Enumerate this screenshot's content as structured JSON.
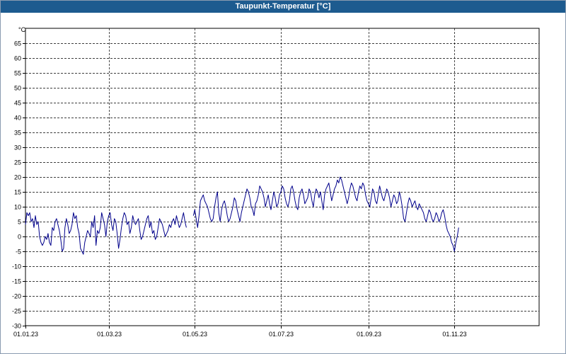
{
  "window": {
    "title": "Taupunkt-Temperatur [°C]"
  },
  "chart_data": {
    "type": "line",
    "title": "Taupunkt-Temperatur [°C]",
    "ylabel": "",
    "y_unit": "°C",
    "ylim": [
      -30,
      70
    ],
    "xlim": [
      "2023-01-01",
      "2023-12-31"
    ],
    "grid": true,
    "line_color": "#00008b",
    "y_ticks": [
      "-30",
      "-25",
      "-20",
      "-15",
      "-10",
      "-5",
      "0",
      "5",
      "10",
      "15",
      "20",
      "25",
      "30",
      "35",
      "40",
      "45",
      "50",
      "55",
      "60",
      "65"
    ],
    "x_ticks": [
      {
        "label": "01.01.23",
        "date": "2023-01-01"
      },
      {
        "label": "01.03.23",
        "date": "2023-03-01"
      },
      {
        "label": "01.05.23",
        "date": "2023-05-01"
      },
      {
        "label": "01.07.23",
        "date": "2023-07-01"
      },
      {
        "label": "01.09.23",
        "date": "2023-09-01"
      },
      {
        "label": "01.11.23",
        "date": "2023-11-01"
      }
    ],
    "series": [
      {
        "segments": [
          {
            "x": [
              "2023-01-01",
              "2023-01-02",
              "2023-01-03",
              "2023-01-04",
              "2023-01-05",
              "2023-01-06",
              "2023-01-07",
              "2023-01-08",
              "2023-01-09",
              "2023-01-10",
              "2023-01-11",
              "2023-01-12",
              "2023-01-13",
              "2023-01-14",
              "2023-01-15",
              "2023-01-16",
              "2023-01-17",
              "2023-01-18",
              "2023-01-19",
              "2023-01-20",
              "2023-01-21",
              "2023-01-22",
              "2023-01-23",
              "2023-01-24",
              "2023-01-25",
              "2023-01-26",
              "2023-01-27",
              "2023-01-28",
              "2023-01-29",
              "2023-01-30",
              "2023-01-31",
              "2023-02-01",
              "2023-02-02",
              "2023-02-03",
              "2023-02-04",
              "2023-02-05",
              "2023-02-06",
              "2023-02-07",
              "2023-02-08",
              "2023-02-09",
              "2023-02-10",
              "2023-02-11",
              "2023-02-12",
              "2023-02-13",
              "2023-02-14",
              "2023-02-15",
              "2023-02-16",
              "2023-02-17",
              "2023-02-18",
              "2023-02-19",
              "2023-02-20",
              "2023-02-21",
              "2023-02-22",
              "2023-02-23",
              "2023-02-24",
              "2023-02-25",
              "2023-02-26",
              "2023-02-27",
              "2023-02-28",
              "2023-03-01",
              "2023-03-02",
              "2023-03-03",
              "2023-03-04",
              "2023-03-05",
              "2023-03-06",
              "2023-03-07",
              "2023-03-08",
              "2023-03-09",
              "2023-03-10",
              "2023-03-11",
              "2023-03-12",
              "2023-03-13",
              "2023-03-14",
              "2023-03-15",
              "2023-03-16",
              "2023-03-17",
              "2023-03-18",
              "2023-03-19",
              "2023-03-20",
              "2023-03-21",
              "2023-03-22",
              "2023-03-23",
              "2023-03-24",
              "2023-03-25",
              "2023-03-26",
              "2023-03-27",
              "2023-03-28",
              "2023-03-29",
              "2023-03-30",
              "2023-03-31",
              "2023-04-01",
              "2023-04-02",
              "2023-04-03",
              "2023-04-04",
              "2023-04-05",
              "2023-04-06",
              "2023-04-07",
              "2023-04-08",
              "2023-04-09",
              "2023-04-10",
              "2023-04-11",
              "2023-04-12",
              "2023-04-13",
              "2023-04-14",
              "2023-04-15",
              "2023-04-16",
              "2023-04-17",
              "2023-04-18",
              "2023-04-19",
              "2023-04-20",
              "2023-04-21",
              "2023-04-22",
              "2023-04-23",
              "2023-04-24",
              "2023-04-25"
            ],
            "y": [
              4,
              8,
              7,
              8,
              5,
              6,
              3,
              7,
              4,
              5,
              0,
              -2,
              -3,
              -2,
              0,
              -1,
              1,
              -2,
              -3,
              3,
              2,
              5,
              6,
              4,
              2,
              -1,
              -5,
              -4,
              3,
              6,
              4,
              1,
              2,
              4,
              8,
              6,
              7,
              3,
              1,
              -4,
              -5,
              -6,
              -2,
              0,
              2,
              1,
              0,
              5,
              3,
              7,
              -3,
              2,
              1,
              3,
              8,
              6,
              4,
              0,
              5,
              7,
              8,
              4,
              2,
              6,
              5,
              1,
              -4,
              -1,
              3,
              6,
              8,
              7,
              4,
              5,
              1,
              3,
              7,
              5,
              4,
              5,
              6,
              2,
              -1,
              0,
              2,
              4,
              6,
              7,
              3,
              5,
              1,
              2,
              -1,
              0,
              3,
              6,
              5,
              4,
              2,
              0,
              1,
              2,
              4,
              3,
              5,
              6,
              4,
              7,
              5,
              3,
              4,
              6,
              8,
              5,
              3
            ],
            "note": ""
          },
          {
            "x": [
              "2023-04-30",
              "2023-05-01",
              "2023-05-02",
              "2023-05-03",
              "2023-05-04",
              "2023-05-05",
              "2023-05-06",
              "2023-05-07",
              "2023-05-08",
              "2023-05-09",
              "2023-05-10",
              "2023-05-11",
              "2023-05-12",
              "2023-05-13",
              "2023-05-14",
              "2023-05-15",
              "2023-05-16",
              "2023-05-17",
              "2023-05-18",
              "2023-05-19",
              "2023-05-20",
              "2023-05-21",
              "2023-05-22",
              "2023-05-23",
              "2023-05-24",
              "2023-05-25",
              "2023-05-26",
              "2023-05-27",
              "2023-05-28",
              "2023-05-29",
              "2023-05-30",
              "2023-05-31",
              "2023-06-01",
              "2023-06-02",
              "2023-06-03",
              "2023-06-04",
              "2023-06-05",
              "2023-06-06",
              "2023-06-07",
              "2023-06-08",
              "2023-06-09",
              "2023-06-10",
              "2023-06-11",
              "2023-06-12",
              "2023-06-13",
              "2023-06-14",
              "2023-06-15",
              "2023-06-16",
              "2023-06-17",
              "2023-06-18",
              "2023-06-19",
              "2023-06-20",
              "2023-06-21",
              "2023-06-22",
              "2023-06-23",
              "2023-06-24",
              "2023-06-25",
              "2023-06-26",
              "2023-06-27",
              "2023-06-28",
              "2023-06-29",
              "2023-06-30",
              "2023-07-01",
              "2023-07-02",
              "2023-07-03",
              "2023-07-04",
              "2023-07-05",
              "2023-07-06",
              "2023-07-07",
              "2023-07-08",
              "2023-07-09",
              "2023-07-10",
              "2023-07-11",
              "2023-07-12",
              "2023-07-13",
              "2023-07-14",
              "2023-07-15",
              "2023-07-16",
              "2023-07-17",
              "2023-07-18",
              "2023-07-19",
              "2023-07-20",
              "2023-07-21",
              "2023-07-22",
              "2023-07-23",
              "2023-07-24",
              "2023-07-25",
              "2023-07-26",
              "2023-07-27",
              "2023-07-28",
              "2023-07-29",
              "2023-07-30",
              "2023-07-31",
              "2023-08-01",
              "2023-08-02",
              "2023-08-03",
              "2023-08-04",
              "2023-08-05",
              "2023-08-06",
              "2023-08-07",
              "2023-08-08",
              "2023-08-09",
              "2023-08-10",
              "2023-08-11",
              "2023-08-12",
              "2023-08-13",
              "2023-08-14",
              "2023-08-15",
              "2023-08-16",
              "2023-08-17",
              "2023-08-18",
              "2023-08-19",
              "2023-08-20",
              "2023-08-21",
              "2023-08-22",
              "2023-08-23",
              "2023-08-24",
              "2023-08-25",
              "2023-08-26",
              "2023-08-27",
              "2023-08-28",
              "2023-08-29",
              "2023-08-30",
              "2023-08-31",
              "2023-09-01",
              "2023-09-02",
              "2023-09-03",
              "2023-09-04",
              "2023-09-05",
              "2023-09-06",
              "2023-09-07",
              "2023-09-08",
              "2023-09-09",
              "2023-09-10",
              "2023-09-11",
              "2023-09-12",
              "2023-09-13",
              "2023-09-14",
              "2023-09-15",
              "2023-09-16",
              "2023-09-17",
              "2023-09-18",
              "2023-09-19",
              "2023-09-20",
              "2023-09-21",
              "2023-09-22",
              "2023-09-23",
              "2023-09-24",
              "2023-09-25",
              "2023-09-26",
              "2023-09-27",
              "2023-09-28",
              "2023-09-29",
              "2023-09-30",
              "2023-10-01",
              "2023-10-02",
              "2023-10-03",
              "2023-10-04",
              "2023-10-05",
              "2023-10-06",
              "2023-10-07",
              "2023-10-08",
              "2023-10-09",
              "2023-10-10",
              "2023-10-11",
              "2023-10-12",
              "2023-10-13",
              "2023-10-14",
              "2023-10-15",
              "2023-10-16",
              "2023-10-17",
              "2023-10-18",
              "2023-10-19",
              "2023-10-20",
              "2023-10-21",
              "2023-10-22",
              "2023-10-23",
              "2023-10-24",
              "2023-10-25",
              "2023-10-26",
              "2023-10-27",
              "2023-10-28",
              "2023-10-29",
              "2023-10-30",
              "2023-10-31",
              "2023-11-01",
              "2023-11-02",
              "2023-11-03",
              "2023-11-04",
              "2023-11-05",
              "2023-11-06",
              "2023-11-07",
              "2023-11-08",
              "2023-11-09",
              "2023-11-10",
              "2023-11-11",
              "2023-11-12",
              "2023-11-13",
              "2023-11-14",
              "2023-11-15",
              "2023-11-16",
              "2023-11-17",
              "2023-11-18",
              "2023-11-19",
              "2023-11-20",
              "2023-11-21",
              "2023-11-22",
              "2023-11-23",
              "2023-11-24",
              "2023-11-25",
              "2023-11-26",
              "2023-11-27",
              "2023-11-28",
              "2023-11-29",
              "2023-11-30",
              "2023-12-01",
              "2023-12-02"
            ],
            "y": [
              7,
              9,
              6,
              3,
              7,
              12,
              13,
              14,
              12,
              11,
              10,
              8,
              6,
              5,
              6,
              10,
              13,
              15,
              8,
              5,
              9,
              11,
              12,
              10,
              7,
              5,
              6,
              8,
              10,
              13,
              12,
              9,
              7,
              5,
              8,
              10,
              12,
              14,
              16,
              15,
              13,
              10,
              9,
              7,
              11,
              12,
              14,
              17,
              16,
              15,
              13,
              10,
              12,
              14,
              11,
              9,
              12,
              15,
              13,
              10,
              11,
              14,
              15,
              17,
              16,
              13,
              11,
              10,
              12,
              16,
              17,
              15,
              12,
              10,
              9,
              13,
              15,
              16,
              14,
              11,
              12,
              13,
              16,
              15,
              12,
              10,
              14,
              16,
              15,
              13,
              15,
              12,
              9,
              14,
              16,
              17,
              18,
              15,
              12,
              14,
              16,
              17,
              19,
              18,
              20,
              19,
              17,
              15,
              13,
              11,
              13,
              16,
              18,
              17,
              15,
              13,
              12,
              15,
              17,
              16,
              18,
              17,
              14,
              12,
              11,
              10,
              13,
              16,
              15,
              12,
              11,
              14,
              17,
              15,
              13,
              12,
              14,
              16,
              15,
              13,
              10,
              12,
              14,
              13,
              11,
              12,
              15,
              13,
              10,
              6,
              5,
              8,
              11,
              13,
              12,
              10,
              11,
              12,
              10,
              9,
              11,
              10,
              9,
              8,
              6,
              5,
              7,
              9,
              8,
              6,
              5,
              6,
              8,
              7,
              5,
              6,
              8,
              9,
              7,
              4,
              2,
              1,
              0,
              -2,
              -3,
              -5,
              -2,
              0,
              3
            ]
          }
        ]
      }
    ]
  }
}
